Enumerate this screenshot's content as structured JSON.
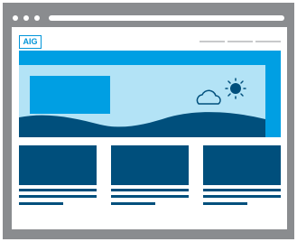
{
  "window": {
    "controls": [
      "close",
      "minimize",
      "maximize"
    ]
  },
  "header": {
    "logo_text": "AIG",
    "nav_items": [
      "",
      "",
      ""
    ]
  },
  "hero": {
    "icons": [
      "cloud-icon",
      "sun-icon"
    ]
  },
  "cards": [
    {},
    {},
    {}
  ],
  "colors": {
    "frame": "#8a8c8f",
    "brand": "#009fe3",
    "hero_bg": "#b3e3f6",
    "wave": "#004f7c",
    "nav": "#c8c9cb"
  }
}
